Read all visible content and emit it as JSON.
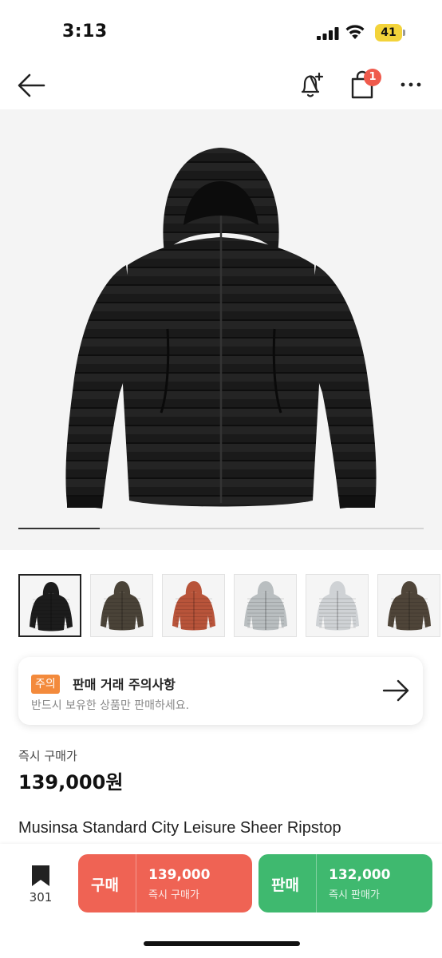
{
  "status_bar": {
    "time": "3:13",
    "battery_level": "41",
    "signal_icon": "cellular-signal-icon",
    "wifi_icon": "wifi-icon"
  },
  "nav": {
    "back_icon": "arrow-left-icon",
    "notification_icon": "bell-plus-icon",
    "cart_icon": "shopping-bag-icon",
    "cart_badge": "1",
    "more_icon": "more-horizontal-icon"
  },
  "hero": {
    "image": "black-hooded-puffer-jacket",
    "progress": 0.2
  },
  "thumbnails": [
    {
      "color": "#1c1c1c",
      "selected": true
    },
    {
      "color": "#4a4338",
      "selected": false
    },
    {
      "color": "#b8543a",
      "selected": false
    },
    {
      "color": "#b9bec0",
      "selected": false
    },
    {
      "color": "#cfd2d5",
      "selected": false
    },
    {
      "color": "#4f4539",
      "selected": false
    }
  ],
  "notice": {
    "tag": "주의",
    "title": "판매 거래 주의사항",
    "subtitle": "반드시 보유한 상품만 판매하세요.",
    "arrow_icon": "arrow-right-icon"
  },
  "price": {
    "label": "즉시 구매가",
    "value": "139,000원"
  },
  "product": {
    "name": "Musinsa Standard City Leisure Sheer Ripstop"
  },
  "bottom_bar": {
    "bookmark_icon": "bookmark-icon",
    "bookmark_count": "301",
    "buy": {
      "label": "구매",
      "price": "139,000",
      "sub": "즉시 구매가"
    },
    "sell": {
      "label": "판매",
      "price": "132,000",
      "sub": "즉시 판매가"
    }
  },
  "colors": {
    "buy": "#ef6354",
    "sell": "#3fb96f",
    "badge": "#ef5a4c",
    "notice_tag": "#f38a3c",
    "battery": "#f3d33a"
  }
}
